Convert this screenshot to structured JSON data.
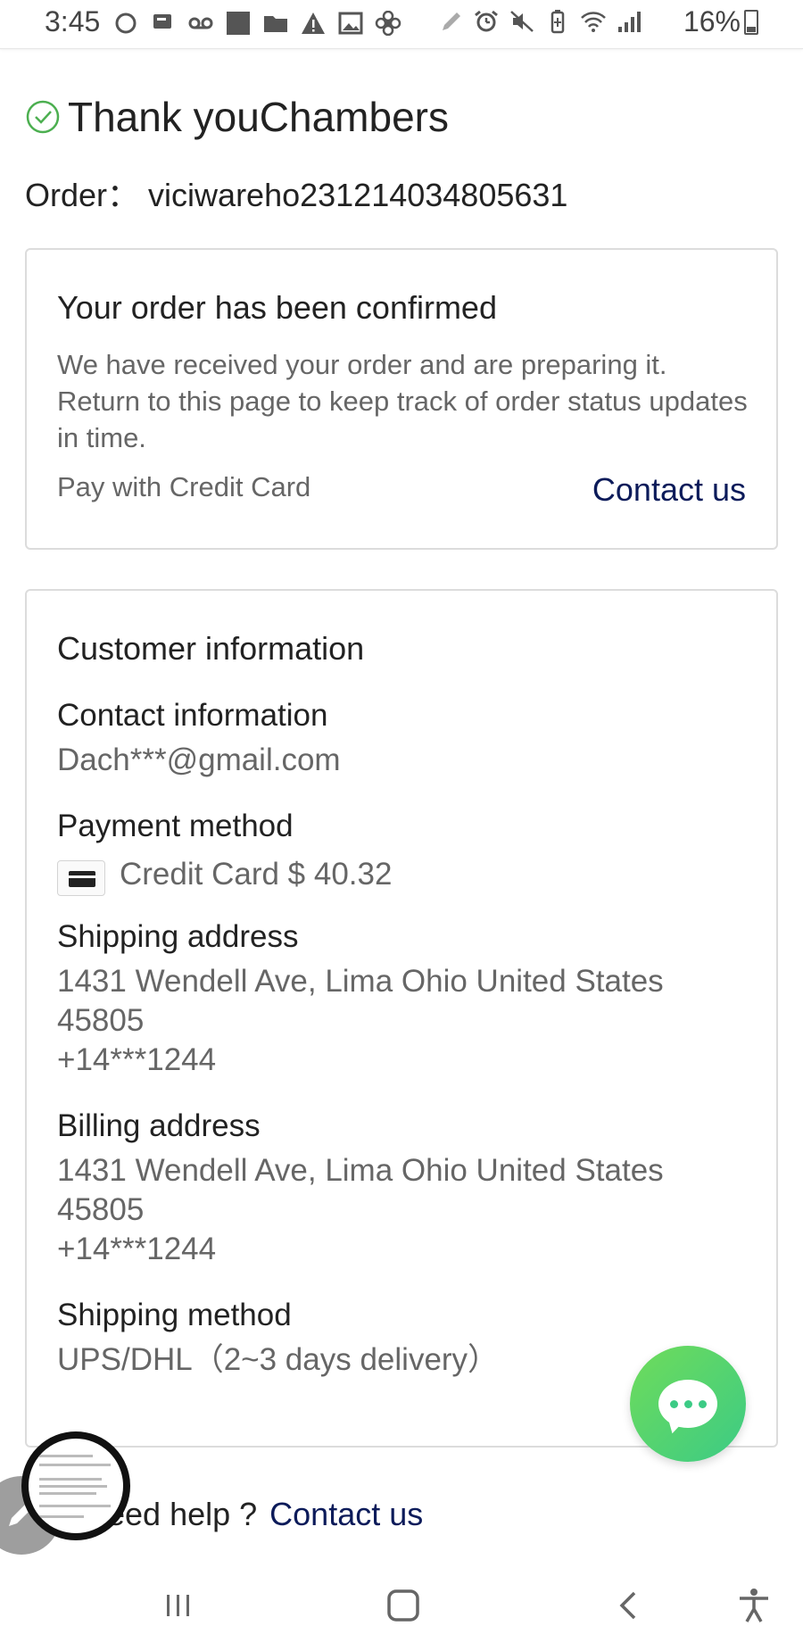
{
  "status_bar": {
    "time": "3:45",
    "battery": "16%",
    "left_icons": [
      "circle-icon",
      "messages-icon",
      "voicemail-icon",
      "square-icon",
      "folder-icon",
      "warning-icon",
      "image-icon",
      "pinwheel-icon"
    ],
    "right_icons": [
      "pencil-icon",
      "alarm-icon",
      "mute-icon",
      "battery-saver-icon",
      "wifi-icon",
      "signal-icon"
    ]
  },
  "header": {
    "title": "Thank youChambers",
    "order_label": "Order：",
    "order_number": "viciwareho231214034805631"
  },
  "confirmation": {
    "title": "Your order has been confirmed",
    "message": "We have received your order and are preparing it. Return to this page to keep track of order status updates in time.",
    "payment_note": "Pay with Credit Card",
    "contact_link": "Contact us"
  },
  "customer_info": {
    "title": "Customer information",
    "contact": {
      "label": "Contact information",
      "value": "Dach***@gmail.com"
    },
    "payment": {
      "label": "Payment method",
      "value": "Credit Card $ 40.32"
    },
    "shipping_address": {
      "label": "Shipping address",
      "line1": "1431 Wendell Ave, Lima Ohio United States",
      "line2": "45805",
      "line3": "+14***1244"
    },
    "billing_address": {
      "label": "Billing address",
      "line1": "1431 Wendell Ave, Lima Ohio United States",
      "line2": "45805",
      "line3": "+14***1244"
    },
    "shipping_method": {
      "label": "Shipping method",
      "value": "UPS/DHL（2~3 days delivery）"
    }
  },
  "help": {
    "text": "eed help ?",
    "link": "Contact us"
  },
  "colors": {
    "accent_green": "#3ccb85",
    "link_navy": "#0c1b5a",
    "check_green": "#4caf50"
  }
}
